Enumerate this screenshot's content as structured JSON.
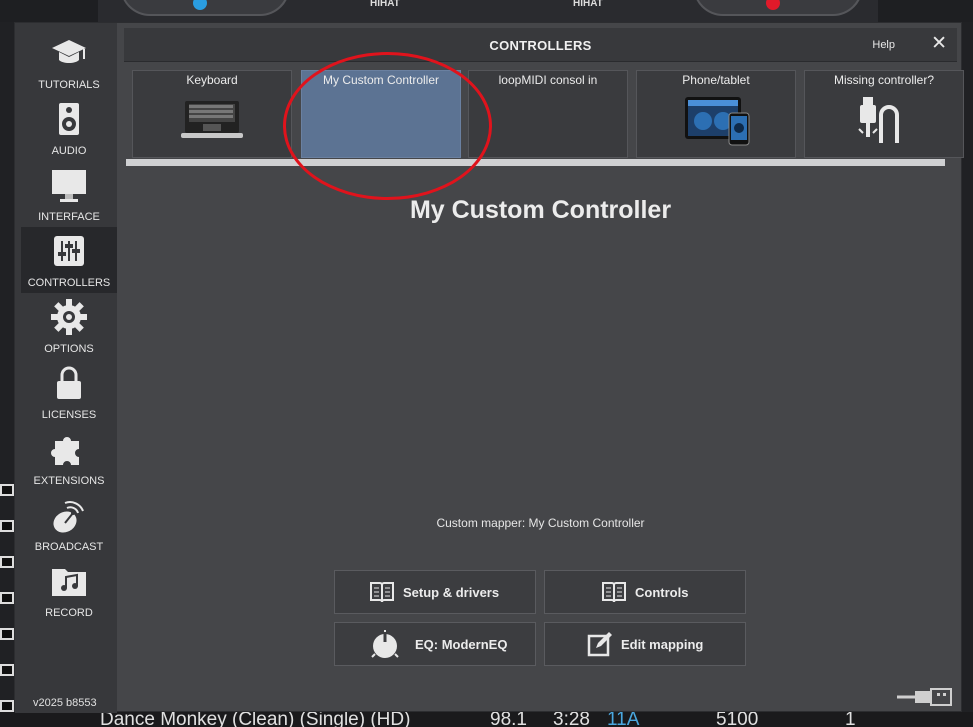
{
  "background": {
    "deck_labels": [
      "HIHAT",
      "HIHAT"
    ],
    "track_row": {
      "title": "Dance Monkey (Clean) (Single) (HD)",
      "bpm": "98.1",
      "length": "3:28",
      "key": "11A",
      "col5": "5100",
      "col6": "1"
    }
  },
  "sidebar": {
    "items": [
      {
        "label": "TUTORIALS",
        "icon": "graduation-cap-icon"
      },
      {
        "label": "AUDIO",
        "icon": "speaker-icon"
      },
      {
        "label": "INTERFACE",
        "icon": "monitor-icon"
      },
      {
        "label": "CONTROLLERS",
        "icon": "sliders-icon",
        "active": true
      },
      {
        "label": "OPTIONS",
        "icon": "gear-icon"
      },
      {
        "label": "LICENSES",
        "icon": "lock-icon"
      },
      {
        "label": "EXTENSIONS",
        "icon": "puzzle-icon"
      },
      {
        "label": "BROADCAST",
        "icon": "broadcast-icon"
      },
      {
        "label": "RECORD",
        "icon": "music-folder-icon"
      }
    ],
    "version": "v2025 b8553"
  },
  "panel": {
    "title": "CONTROLLERS",
    "help_label": "Help",
    "close_label": "✕",
    "tiles": [
      {
        "label": "Keyboard"
      },
      {
        "label": "My Custom Controller",
        "selected": true
      },
      {
        "label": "loopMIDI consol in"
      },
      {
        "label": "Phone/tablet"
      },
      {
        "label": "Missing controller?"
      }
    ],
    "heading": "My Custom Controller",
    "mapper_text": "Custom mapper: My Custom Controller",
    "buttons": {
      "setup": "Setup & drivers",
      "controls": "Controls",
      "eq": "EQ: ModernEQ",
      "edit": "Edit mapping"
    }
  },
  "colors": {
    "accent_selected": "#5c7393",
    "annotation_red": "#e0131c",
    "deck_blue": "#2a9de0",
    "deck_red": "#e01a2a"
  }
}
